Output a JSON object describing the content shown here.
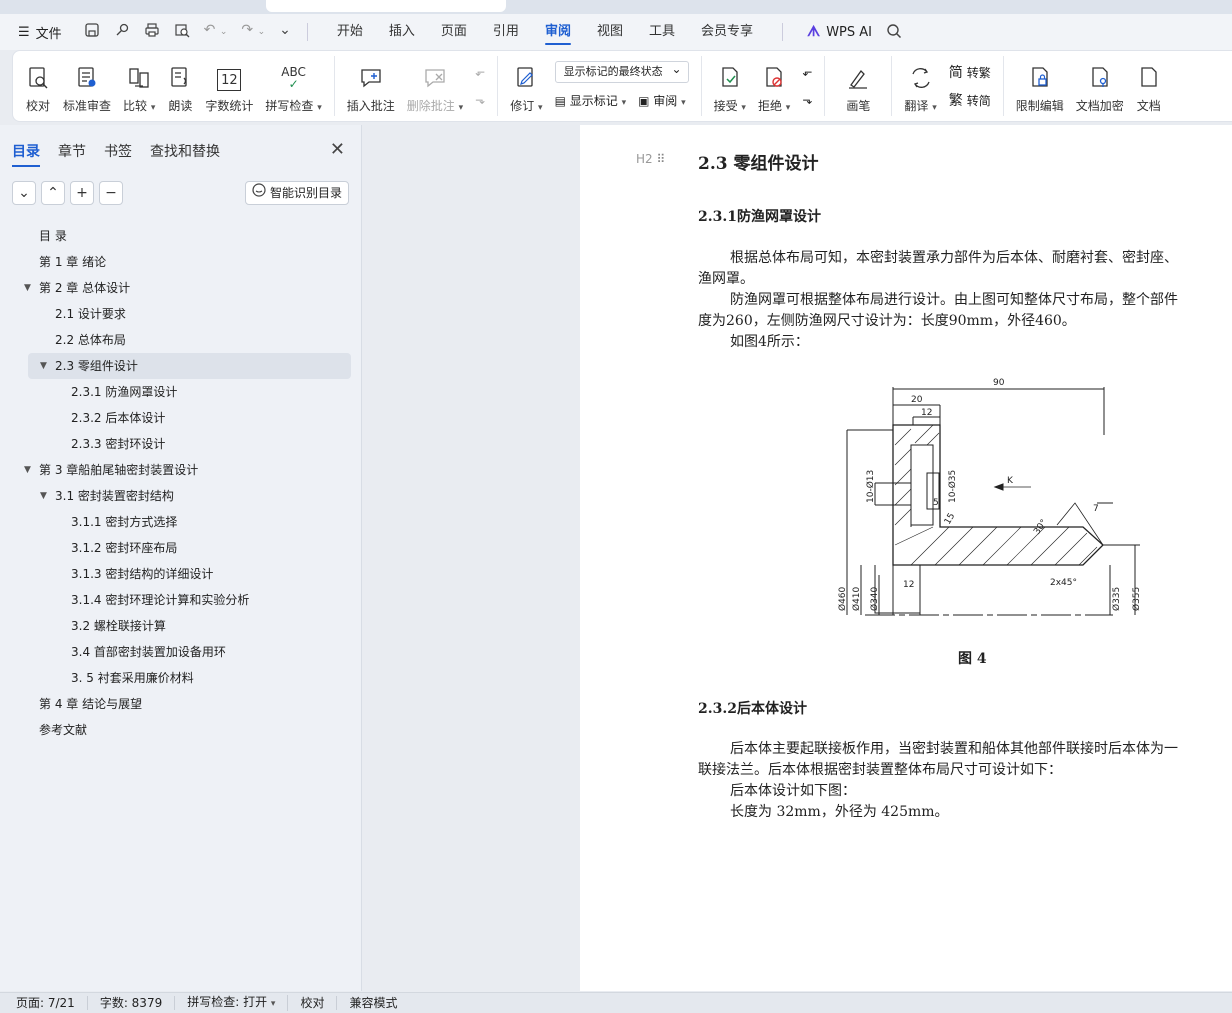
{
  "menubar": {
    "file_label": "文件",
    "tabs": [
      "开始",
      "插入",
      "页面",
      "引用",
      "审阅",
      "视图",
      "工具",
      "会员专享"
    ],
    "active_tab": "审阅",
    "ai_label": "WPS AI"
  },
  "ribbon": {
    "proof": "校对",
    "standard_review": "标准审查",
    "compare": "比较",
    "read_aloud": "朗读",
    "word_count": "字数统计",
    "word_count_icon_text": "12",
    "spell_check": "拼写检查",
    "spell_icon_text": "ABC",
    "insert_comment": "插入批注",
    "delete_comment": "删除批注",
    "track_changes": "修订",
    "markup_select": "显示标记的最终状态",
    "show_markup": "显示标记",
    "review": "审阅",
    "accept": "接受",
    "reject": "拒绝",
    "pen": "画笔",
    "translate": "翻译",
    "to_traditional": "转繁",
    "to_simplified": "转简",
    "trad_glyph": "繁",
    "simp_glyph": "简",
    "restrict_edit": "限制编辑",
    "doc_encrypt": "文档加密",
    "doc_more": "文档"
  },
  "nav": {
    "tabs": [
      "目录",
      "章节",
      "书签",
      "查找和替换"
    ],
    "smart_button": "智能识别目录",
    "toc": [
      {
        "text": "目 录",
        "level": 0,
        "arrow": false
      },
      {
        "text": "第 1 章  绪论",
        "level": 0,
        "arrow": false
      },
      {
        "text": "第 2 章  总体设计",
        "level": 0,
        "arrow": true
      },
      {
        "text": "2.1  设计要求",
        "level": 1,
        "arrow": false
      },
      {
        "text": "2.2    总体布局",
        "level": 1,
        "arrow": false
      },
      {
        "text": "2.3    零组件设计",
        "level": 1,
        "arrow": true,
        "selected": true
      },
      {
        "text": "2.3.1 防渔网罩设计",
        "level": 2,
        "arrow": false
      },
      {
        "text": "2.3.2 后本体设计",
        "level": 2,
        "arrow": false
      },
      {
        "text": "2.3.3 密封环设计",
        "level": 2,
        "arrow": false
      },
      {
        "text": "第 3 章船舶尾轴密封装置设计",
        "level": 0,
        "arrow": true
      },
      {
        "text": "3.1  密封装置密封结构",
        "level": 1,
        "arrow": true
      },
      {
        "text": "3.1.1 密封方式选择",
        "level": 2,
        "arrow": false
      },
      {
        "text": "3.1.2 密封环座布局",
        "level": 2,
        "arrow": false
      },
      {
        "text": "3.1.3 密封结构的详细设计",
        "level": 2,
        "arrow": false
      },
      {
        "text": "3.1.4 密封环理论计算和实验分析",
        "level": 2,
        "arrow": false
      },
      {
        "text": "3.2 螺栓联接计算",
        "level": 2,
        "arrow": false
      },
      {
        "text": "3.4 首部密封装置加设备用环",
        "level": 2,
        "arrow": false
      },
      {
        "text": "3. 5 衬套采用廉价材料",
        "level": 2,
        "arrow": false
      },
      {
        "text": "第 4 章  结论与展望",
        "level": 0,
        "arrow": false
      },
      {
        "text": "参考文献",
        "level": 0,
        "arrow": false
      }
    ]
  },
  "doc": {
    "h2_marker": "H2",
    "h2_title": "2.3   零组件设计",
    "h3_1": "2.3.1防渔网罩设计",
    "p1_l1": "根据总体布局可知，本密封装置承力部件为后本体、耐磨衬套、密封座、",
    "p1_l2": "渔网罩。",
    "p2_l1": "防渔网罩可根据整体布局进行设计。由上图可知整体尺寸布局，整个部件",
    "p2_l2": "度为260，左侧防渔网尺寸设计为：长度90mm，外径460。",
    "p3": "如图4所示：",
    "figure_caption": "图 4",
    "h3_2": "2.3.2后本体设计",
    "p4_l1": "后本体主要起联接板作用，当密封装置和船体其他部件联接时后本体为一",
    "p4_l2": "联接法兰。后本体根据密封装置整体布局尺寸可设计如下：",
    "p5": "后本体设计如下图：",
    "p6": "长度为 32mm，外径为 425mm。",
    "dims": {
      "d90": "90",
      "d20": "20",
      "d12a": "12",
      "d12b": "12",
      "d7": "7",
      "d10_13": "10-Ø13",
      "d10_35": "10-Ø35",
      "d5": "5",
      "d15": "15",
      "d30": "30°",
      "chamfer": "2x45°",
      "k": "K",
      "d460": "Ø460",
      "d410": "Ø410",
      "d340": "Ø340",
      "d335": "Ø335",
      "d355": "Ø355"
    }
  },
  "status": {
    "page": "页面: 7/21",
    "words": "字数: 8379",
    "spell": "拼写检查: 打开",
    "proof": "校对",
    "compat": "兼容模式"
  }
}
